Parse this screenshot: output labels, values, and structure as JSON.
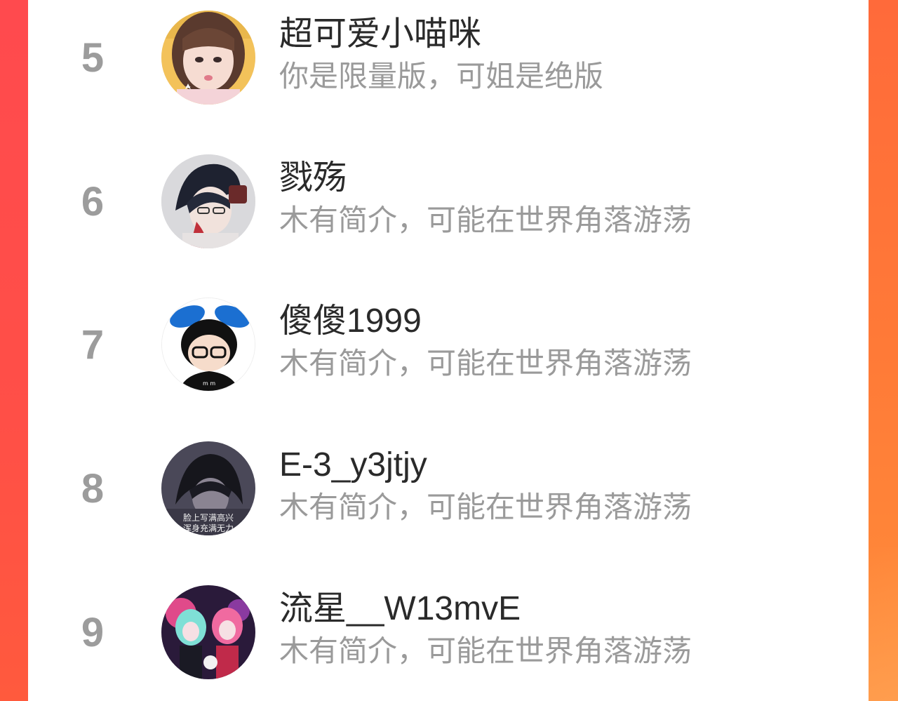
{
  "users": [
    {
      "rank": "5",
      "name": "超可爱小喵咪",
      "bio": "你是限量版，可姐是绝版",
      "avatar": "user-avatar-girl-photo"
    },
    {
      "rank": "6",
      "name": "戮殇",
      "bio": "木有简介，可能在世界角落游荡",
      "avatar": "user-avatar-anime-boy"
    },
    {
      "rank": "7",
      "name": "傻傻1999",
      "bio": "木有简介，可能在世界角落游荡",
      "avatar": "user-avatar-bunny-ears-cartoon"
    },
    {
      "rank": "8",
      "name": "E-3_y3jtjy",
      "bio": "木有简介，可能在世界角落游荡",
      "avatar": "user-avatar-dark-anime",
      "avatar_text": [
        "脸上写满高兴",
        "浑身充满无力"
      ]
    },
    {
      "rank": "9",
      "name": "流星__W13mvE",
      "bio": "木有简介，可能在世界角落游荡",
      "avatar": "user-avatar-anime-pair"
    }
  ],
  "colors": {
    "rank": "#9c9c9c",
    "name": "#2a2a2a",
    "bio": "#9a9a9a",
    "accent_left": "#ff4a4a",
    "accent_right": "#ff7a3c"
  }
}
